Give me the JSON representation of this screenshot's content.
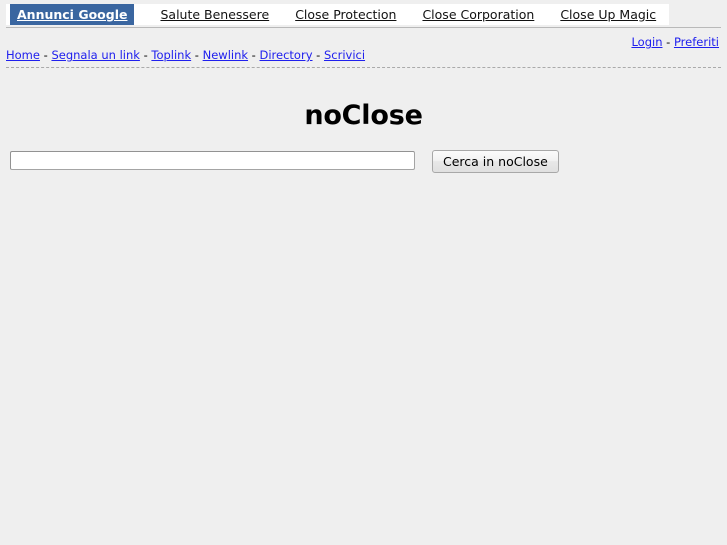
{
  "page": {
    "background_color": "#efefef",
    "title": "noClose"
  },
  "adbar": {
    "background_color": "#ffffff",
    "highlight_color": "#3a66a0",
    "items": [
      {
        "label": "Annunci Google",
        "highlighted": true
      },
      {
        "label": "Salute Benessere",
        "highlighted": false
      },
      {
        "label": "Close Protection",
        "highlighted": false
      },
      {
        "label": "Close Corporation",
        "highlighted": false
      },
      {
        "label": "Close Up Magic",
        "highlighted": false
      }
    ]
  },
  "userlinks": {
    "login_label": "Login",
    "separator": " - ",
    "preferiti_label": "Preferiti"
  },
  "mainnav": {
    "separator": " - ",
    "items": [
      {
        "label": "Home"
      },
      {
        "label": "Segnala un link"
      },
      {
        "label": "Toplink"
      },
      {
        "label": "Newlink"
      },
      {
        "label": "Directory"
      },
      {
        "label": "Scrivici"
      }
    ],
    "link_color": "#2020ee"
  },
  "site": {
    "heading": "noClose"
  },
  "search": {
    "value": "",
    "placeholder": "",
    "button_label": "Cerca in noClose"
  }
}
